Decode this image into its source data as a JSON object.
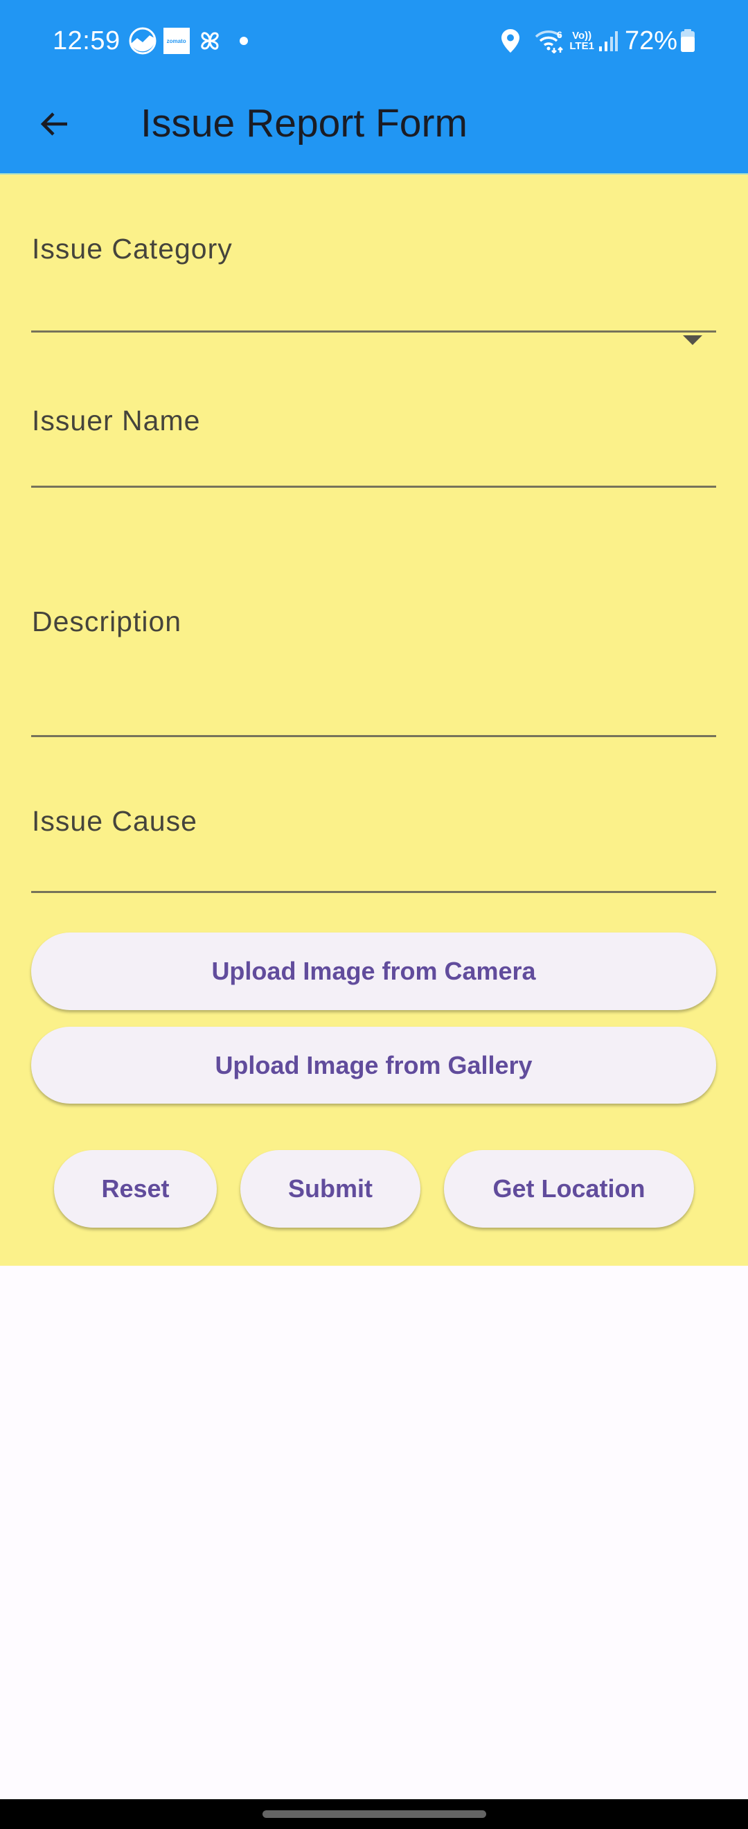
{
  "status_bar": {
    "time": "12:59",
    "notification_icons": [
      "analytics-app-icon",
      "zomato-icon",
      "pinwheel-icon",
      "more-notifications-dot"
    ],
    "zomato_label": "zomato",
    "system_icons": [
      "location-icon",
      "wifi-6-icon",
      "volte-lte1-icon",
      "signal-icon",
      "battery-icon"
    ],
    "wifi_badge": "6",
    "lte_top": "Vo))",
    "lte_bottom": "LTE1",
    "battery_percent": "72%"
  },
  "app_bar": {
    "title": "Issue Report Form",
    "back_icon": "arrow-back-icon",
    "color": "#2196F3"
  },
  "form": {
    "background": "#FBF18A",
    "fields": [
      {
        "name": "issue-category",
        "label": "Issue Category",
        "type": "dropdown",
        "value": ""
      },
      {
        "name": "issuer-name",
        "label": "Issuer Name",
        "type": "text",
        "value": ""
      },
      {
        "name": "description",
        "label": "Description",
        "type": "multiline",
        "value": ""
      },
      {
        "name": "issue-cause",
        "label": "Issue Cause",
        "type": "text",
        "value": ""
      }
    ],
    "upload_camera_label": "Upload Image from Camera",
    "upload_gallery_label": "Upload Image from Gallery",
    "reset_label": "Reset",
    "submit_label": "Submit",
    "get_location_label": "Get Location",
    "button_text_color": "#614C9C"
  }
}
